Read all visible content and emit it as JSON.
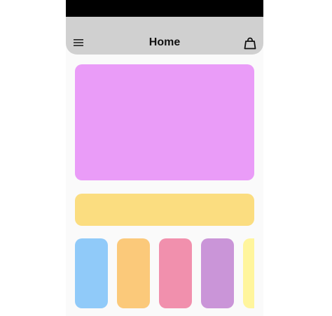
{
  "header": {
    "title": "Home",
    "menu_icon": "hamburger-menu-icon",
    "bag_icon": "shopping-bag-icon"
  },
  "colors": {
    "status_bar": "#000000",
    "app_bar": "#d0d0d0",
    "hero_card": "#ea9cf8",
    "banner_card": "#fbdd80"
  },
  "category_tiles": [
    {
      "color": "#90caf9"
    },
    {
      "color": "#fbc97a"
    },
    {
      "color": "#f190ad"
    },
    {
      "color": "#ca95d8"
    },
    {
      "color": "#fff59d"
    }
  ]
}
